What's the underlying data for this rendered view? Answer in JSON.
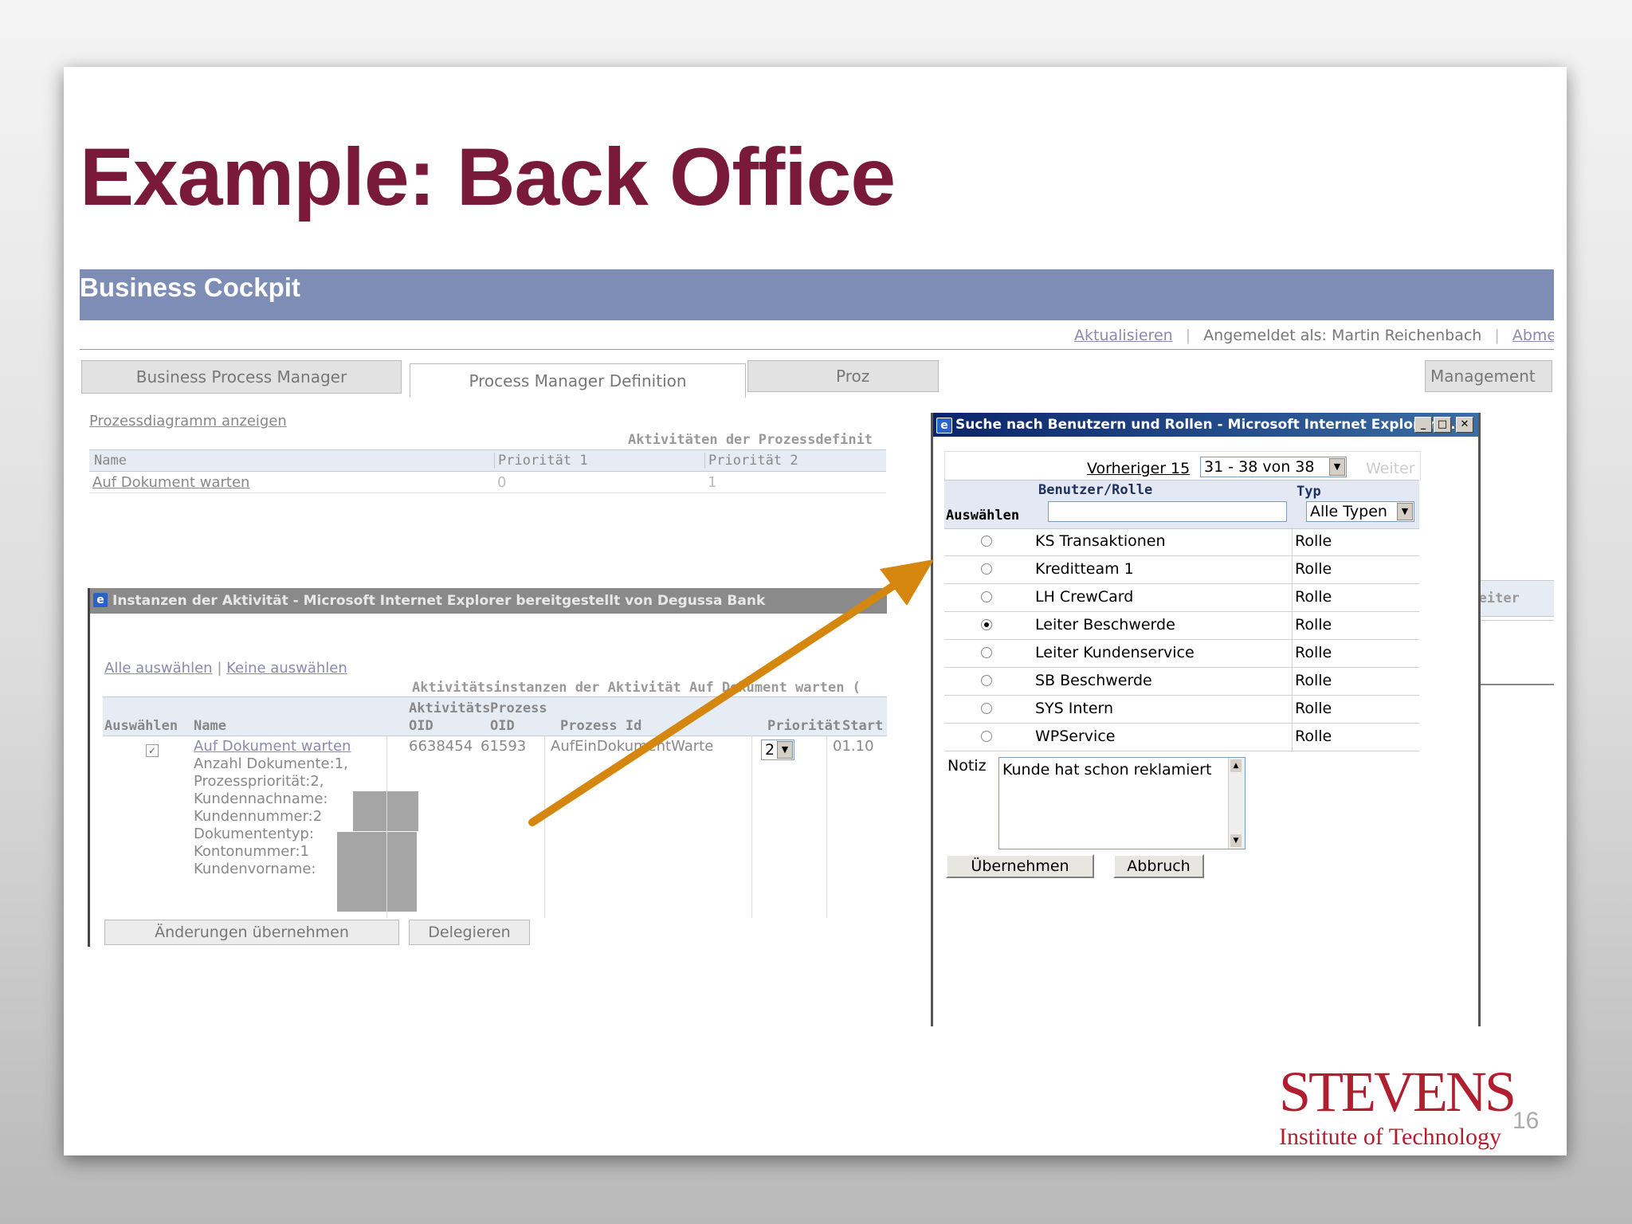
{
  "slide": {
    "title": "Example: Back Office",
    "page_number": "16",
    "logo_main": "STEVENS",
    "logo_sub": "Institute of Technology"
  },
  "cockpit": {
    "title": "Business Cockpit",
    "refresh_link": "Aktualisieren",
    "logged_in_as": "Angemeldet als: Martin Reichenbach",
    "logout_partial": "Abme",
    "tabs": [
      "Business Process Manager",
      "Process Manager Definition",
      "Proz",
      "Management"
    ],
    "diagram_link": "Prozessdiagramm anzeigen",
    "activities_header": "Aktivitäten der Prozessdefinit",
    "columns": [
      "Name",
      "Priorität 1",
      "Priorität 2"
    ],
    "row": {
      "name": "Auf Dokument warten",
      "p1": "0",
      "p2": "1"
    },
    "right_partial": "r Bearbeiter"
  },
  "instances_popup": {
    "window_title": "Instanzen der Aktivität - Microsoft Internet Explorer bereitgestellt von Degussa Bank",
    "select_all": "Alle auswählen",
    "select_none": "Keine auswählen",
    "group_header": "Aktivitätsinstanzen der Aktivität Auf Dokument warten (",
    "col_select": "Auswählen",
    "col_name": "Name",
    "col_act_oid_1": "Aktivitäts",
    "col_act_oid_2": "OID",
    "col_proc_oid_1": "Prozess",
    "col_proc_oid_2": "OID",
    "col_proc_id": "Prozess Id",
    "col_priority": "Priorität",
    "col_start": "Start",
    "row": {
      "name_link": "Auf Dokument warten",
      "details": [
        "Anzahl Dokumente:1,",
        "Prozesspriorität:2,",
        "Kundennachname:",
        "Kundennummer:2",
        "Dokumententyp:",
        "Kontonummer:1",
        "Kundenvorname:"
      ],
      "act_oid": "6638454",
      "proc_oid": "61593",
      "proc_id": "AufEinDokumentWarte",
      "priority": "2",
      "start": "01.10"
    },
    "btn_apply": "Änderungen übernehmen",
    "btn_delegate": "Delegieren"
  },
  "search_dialog": {
    "window_title": "Suche nach Benutzern und Rollen - Microsoft Internet Explorer ...",
    "prev_link": "Vorheriger 15",
    "range": "31 - 38 von 38",
    "next_link": "Weiter",
    "col_user_role": "Benutzer/Rolle",
    "col_type": "Typ",
    "col_select": "Auswählen",
    "filter_input_value": "",
    "type_filter": "Alle Typen",
    "rows": [
      {
        "name": "KS Transaktionen",
        "type": "Rolle",
        "selected": false
      },
      {
        "name": "Kreditteam 1",
        "type": "Rolle",
        "selected": false
      },
      {
        "name": "LH CrewCard",
        "type": "Rolle",
        "selected": false
      },
      {
        "name": "Leiter Beschwerde",
        "type": "Rolle",
        "selected": true
      },
      {
        "name": "Leiter Kundenservice",
        "type": "Rolle",
        "selected": false
      },
      {
        "name": "SB Beschwerde",
        "type": "Rolle",
        "selected": false
      },
      {
        "name": "SYS Intern",
        "type": "Rolle",
        "selected": false
      },
      {
        "name": "WPService",
        "type": "Rolle",
        "selected": false
      }
    ],
    "note_label": "Notiz",
    "note_value": "Kunde hat schon reklamiert",
    "btn_apply": "Übernehmen",
    "btn_cancel": "Abbruch"
  },
  "colors": {
    "title": "#7a1a3a",
    "cockpit_bar": "#7d8db5",
    "arrow": "#d4860f",
    "logo": "#b01e2f"
  }
}
